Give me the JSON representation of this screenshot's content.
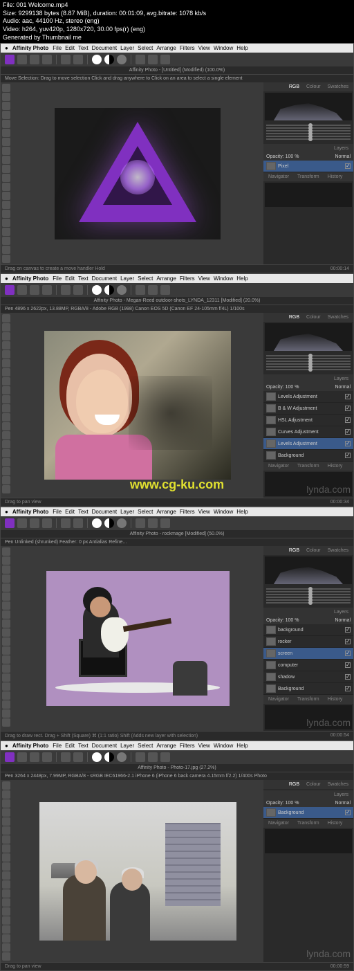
{
  "meta": {
    "file": "File: 001 Welcome.mp4",
    "size": "Size: 9299138 bytes (8.87 MiB), duration: 00:01:09, avg.bitrate: 1078 kb/s",
    "audio": "Audio: aac, 44100 Hz, stereo (eng)",
    "video": "Video: h264, yuv420p, 1280x720, 30.00 fps(r) (eng)",
    "gen": "Generated by Thumbnail me"
  },
  "menu": {
    "app": "Affinity Photo",
    "items": [
      "File",
      "Edit",
      "Text",
      "Document",
      "Layer",
      "Select",
      "Arrange",
      "Filters",
      "View",
      "Window",
      "Help"
    ]
  },
  "frames": [
    {
      "title": "Affinity Photo - [Untitled] (Modified) (100.0%)",
      "context_left": "Move Selection: Drag to move selection  Click and drag anywhere to  Click on an area to select a single element",
      "context_right": "",
      "timestamp": "00:00:14",
      "panel_tabs": [
        "RGB",
        "Colour",
        "Swatches"
      ],
      "nav_tabs": [
        "Navigator",
        "Transform",
        "History"
      ],
      "layers_head_left": "Opacity: 100 %",
      "layers_head_right": "Normal",
      "layers_label": "Layers",
      "layers": [
        {
          "name": "Pixel",
          "sel": true
        }
      ],
      "bottom": "Drag on canvas to create a move handler  Hold",
      "watermark_lynda": "",
      "watermark_cgku": ""
    },
    {
      "title": "Affinity Photo - Megan-Reed outdoor-shots_LYNDA_12311 [Modified] (20.0%)",
      "context_left": "Pen    4896 x 2622px, 13.88MP, RGBA/8 - Adobe RGB (1998)    Canon EOS 5D (Canon EF 24-105mm f/4L)    1/100s",
      "context_right": "",
      "timestamp": "00:00:34",
      "panel_tabs": [
        "RGB",
        "Colour",
        "Swatches"
      ],
      "nav_tabs": [
        "Navigator",
        "Transform",
        "History"
      ],
      "layers_head_left": "Opacity: 100 %",
      "layers_head_right": "Normal",
      "layers_label": "Layers",
      "layers": [
        {
          "name": "Levels Adjustment",
          "sel": false
        },
        {
          "name": "B & W Adjustment",
          "sel": false
        },
        {
          "name": "HSL Adjustment",
          "sel": false
        },
        {
          "name": "Curves Adjustment",
          "sel": false
        },
        {
          "name": "Levels Adjustment",
          "sel": true
        },
        {
          "name": "Background",
          "sel": false
        }
      ],
      "bottom": "Drag to pan view",
      "watermark_lynda": "lynda.com",
      "watermark_cgku": "www.cg-ku.com"
    },
    {
      "title": "Affinity Photo - rockmage [Modified] (50.0%)",
      "context_left": "Pen    Unlinked   (shrunked)     Feather: 0 px        Antialias     Refine...",
      "context_right": "",
      "timestamp": "00:00:54",
      "panel_tabs": [
        "RGB",
        "Colour",
        "Swatches"
      ],
      "nav_tabs": [
        "Navigator",
        "Transform",
        "History"
      ],
      "layers_head_left": "Opacity: 100 %",
      "layers_head_right": "Normal",
      "layers_label": "Layers",
      "layers": [
        {
          "name": "background",
          "sel": false
        },
        {
          "name": "rocker",
          "sel": false
        },
        {
          "name": "screen",
          "sel": true
        },
        {
          "name": "computer",
          "sel": false
        },
        {
          "name": "shadow",
          "sel": false
        },
        {
          "name": "Background",
          "sel": false
        }
      ],
      "bottom": "Drag to draw rect.  Drag + Shift (Square) ⌘ (1:1 ratio) Shift (Adds new layer with selection)",
      "watermark_lynda": "lynda.com",
      "watermark_cgku": ""
    },
    {
      "title": "Affinity Photo - Photo-17.jpg (27.2%)",
      "context_left": "Pen    3264 x 2448px, 7.99MP, RGBA/8 - sRGB IEC61966-2.1    iPhone 6 (iPhone 6 back camera 4.15mm f/2.2)    1/400s   Photo",
      "context_right": "",
      "timestamp": "00:00:59",
      "panel_tabs": [
        "RGB",
        "Colour",
        "Swatches"
      ],
      "nav_tabs": [
        "Navigator",
        "Transform",
        "History"
      ],
      "layers_head_left": "Opacity: 100 %",
      "layers_head_right": "Normal",
      "layers_label": "Layers",
      "layers": [
        {
          "name": "Background",
          "sel": true
        }
      ],
      "bottom": "Drag to pan view",
      "watermark_lynda": "lynda.com",
      "watermark_cgku": ""
    }
  ]
}
